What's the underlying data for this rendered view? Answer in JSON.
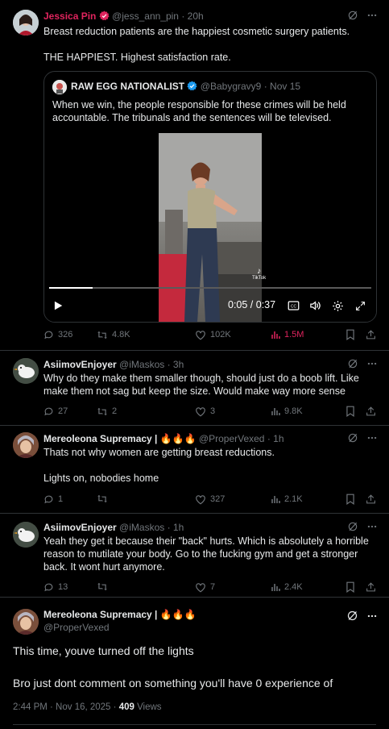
{
  "main_post": {
    "name": "Jessica Pin",
    "handle": "@jess_ann_pin",
    "time": "· 20h",
    "text_line1": "Breast reduction patients are the happiest cosmetic surgery patients.",
    "text_line2": "THE HAPPIEST. Highest satisfaction rate.",
    "quote": {
      "name": "RAW EGG NATIONALIST",
      "handle": "@Babygravy9",
      "time": "· Nov 15",
      "text": "When we win, the people responsible for these crimes will be held accountable. The tribunals and the sentences will be televised.",
      "video_time": "0:05 / 0:37",
      "video_progress": 0.135,
      "tiktok_label": "TikTok"
    },
    "stats": {
      "replies": "326",
      "reposts": "4.8K",
      "likes": "102K",
      "views": "1.5M"
    }
  },
  "replies": [
    {
      "name": "AsiimovEnjoyer",
      "handle": "@iMaskos",
      "time": "· 3h",
      "text": "Why do they make them smaller though, should just do a boob lift. Like make them not sag but keep the size. Would make way more sense",
      "stats": {
        "replies": "27",
        "reposts": "2",
        "likes": "3",
        "views": "9.8K"
      }
    },
    {
      "name": "Mereoleona Supremacy | 🔥🔥🔥",
      "handle": "@ProperVexed",
      "time": "· 1h",
      "text_line1": "Thats not why women are getting breast reductions.",
      "text_line2": "Lights on, nobodies home",
      "stats": {
        "replies": "1",
        "reposts": "",
        "likes": "327",
        "views": "2.1K"
      }
    },
    {
      "name": "AsiimovEnjoyer",
      "handle": "@iMaskos",
      "time": "· 1h",
      "text": "Yeah they get it because their \"back\" hurts. Which is absolutely a horrible reason to mutilate your body. Go to the fucking gym and get a stronger back. It wont hurt anymore.",
      "stats": {
        "replies": "13",
        "reposts": "",
        "likes": "7",
        "views": "2.4K"
      }
    }
  ],
  "focused_post": {
    "name": "Mereoleona Supremacy | 🔥🔥🔥",
    "handle": "@ProperVexed",
    "text_line1": "This time, youve turned off the lights",
    "text_line2": "Bro just dont comment on something you'll have 0 experience of",
    "timestamp": "2:44 PM · Nov 16, 2025 · ",
    "view_count": "409",
    "views_label": " Views"
  },
  "colors": {
    "accent_red": "#e0245e",
    "verified_blue": "#1d9bf0",
    "muted": "#71767b"
  }
}
